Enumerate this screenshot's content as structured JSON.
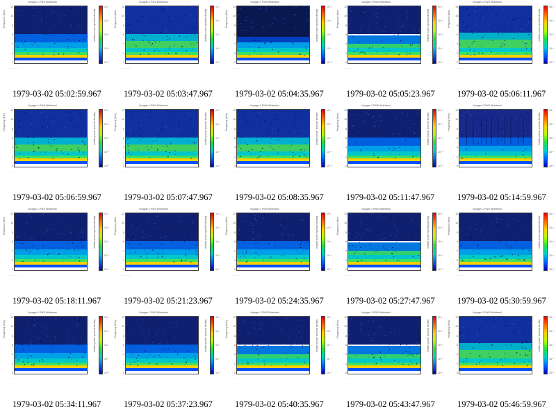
{
  "rows": 4,
  "cols": 5,
  "panel_title": "Voyager-1 PWS Wideband",
  "ylabel": "Frequency (kHz)",
  "cbar_label": "relative power spectral density",
  "y_ticks": [
    "12",
    "10",
    "8",
    "6",
    "4",
    "2",
    "0"
  ],
  "cbar_ticks": [
    "10⁻¹",
    "10⁻²",
    "10⁻³",
    "10⁻⁴",
    "10⁻⁵"
  ],
  "frames": [
    {
      "caption": "1979-03-02 05:02:59.967",
      "variant": "a"
    },
    {
      "caption": "1979-03-02 05:03:47.967",
      "variant": "b"
    },
    {
      "caption": "1979-03-02 05:04:35.967",
      "variant": "c"
    },
    {
      "caption": "1979-03-02 05:05:23.967",
      "variant": "d"
    },
    {
      "caption": "1979-03-02 05:06:11.967",
      "variant": "e"
    },
    {
      "caption": "1979-03-02 05:06:59.967",
      "variant": "b"
    },
    {
      "caption": "1979-03-02 05:07:47.967",
      "variant": "b"
    },
    {
      "caption": "1979-03-02 05:08:35.967",
      "variant": "b"
    },
    {
      "caption": "1979-03-02 05:11:47.967",
      "variant": "a"
    },
    {
      "caption": "1979-03-02 05:14:59.967",
      "variant": "f"
    },
    {
      "caption": "1979-03-02 05:18:11.967",
      "variant": "a"
    },
    {
      "caption": "1979-03-02 05:21:23.967",
      "variant": "a"
    },
    {
      "caption": "1979-03-02 05:24:35.967",
      "variant": "a"
    },
    {
      "caption": "1979-03-02 05:27:47.967",
      "variant": "d"
    },
    {
      "caption": "1979-03-02 05:30:59.967",
      "variant": "a"
    },
    {
      "caption": "1979-03-02 05:34:11.967",
      "variant": "a"
    },
    {
      "caption": "1979-03-02 05:37:23.967",
      "variant": "a"
    },
    {
      "caption": "1979-03-02 05:40:35.967",
      "variant": "d"
    },
    {
      "caption": "1979-03-02 05:43:47.967",
      "variant": "d"
    },
    {
      "caption": "1979-03-02 05:46:59.967",
      "variant": "e"
    }
  ]
}
